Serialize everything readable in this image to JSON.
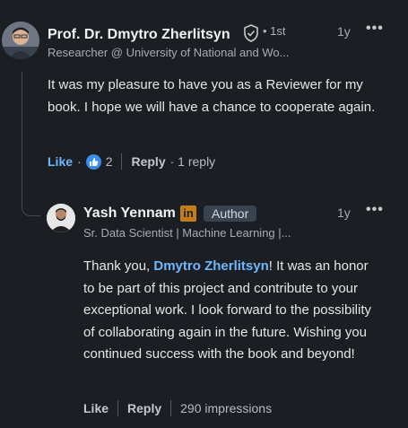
{
  "comment": {
    "author": {
      "name": "Prof. Dr. Dmytro Zherlitsyn",
      "degree": "• 1st",
      "headline": "Researcher @ University of National and Wo...",
      "time": "1y",
      "avatar_icon": "profile-photo"
    },
    "text": "It was my pleasure to have you as a Reviewer for my book. I hope we will have a chance to cooperate again.",
    "actions": {
      "like": "Like",
      "dot": "·",
      "like_count": "2",
      "reply": "Reply",
      "reply_count": "· 1 reply"
    }
  },
  "reply": {
    "author": {
      "name": "Yash Yennam",
      "linkedin_badge": "in",
      "role_badge": "Author",
      "headline": "Sr. Data Scientist | Machine Learning |...",
      "time": "1y",
      "avatar_icon": "profile-photo"
    },
    "text_prefix": " Thank you, ",
    "mention": "Dmytro Zherlitsyn",
    "text_suffix": "! It was an honor to be part of this project and contribute to your exceptional work. I look forward to the possibility of collaborating again in the future. Wishing you continued success with the book and beyond!",
    "actions": {
      "like": "Like",
      "reply": "Reply",
      "impressions": "290 impressions"
    }
  },
  "colors": {
    "background": "#1b1f23",
    "accent_blue": "#71b7fb",
    "like_blue": "#378fe9",
    "linkedin_gold": "#c37d16"
  },
  "more_glyph": "•••"
}
